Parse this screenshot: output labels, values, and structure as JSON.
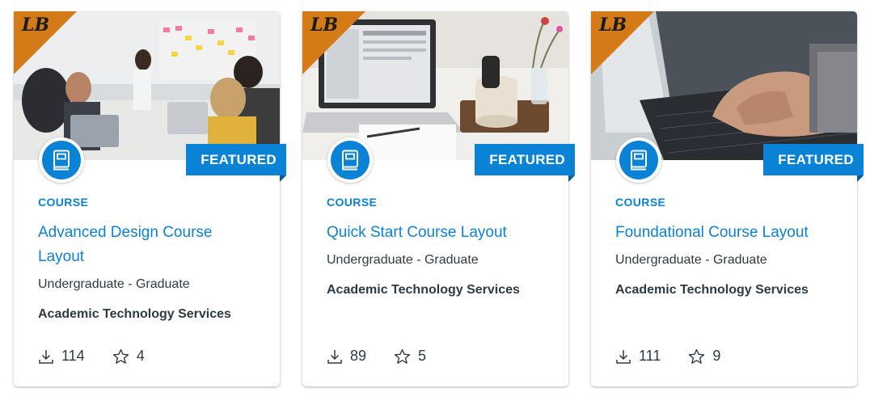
{
  "colors": {
    "accent": "#0a83d6",
    "corner": "#d47a16",
    "text": "#2d3b45"
  },
  "cards": [
    {
      "kind": "COURSE",
      "title": "Advanced Design Course Layout",
      "level": "Undergraduate - Graduate",
      "org": "Academic Technology Services",
      "downloads": "114",
      "favorites": "4",
      "badge": "FEATURED",
      "type_icon": "book-icon",
      "corner_logo": "LB"
    },
    {
      "kind": "COURSE",
      "title": "Quick Start Course Layout",
      "level": "Undergraduate - Graduate",
      "org": "Academic Technology Services",
      "downloads": "89",
      "favorites": "5",
      "badge": "FEATURED",
      "type_icon": "book-icon",
      "corner_logo": "LB"
    },
    {
      "kind": "COURSE",
      "title": "Foundational Course Layout",
      "level": "Undergraduate - Graduate",
      "org": "Academic Technology Services",
      "downloads": "111",
      "favorites": "9",
      "badge": "FEATURED",
      "type_icon": "book-icon",
      "corner_logo": "LB"
    }
  ]
}
